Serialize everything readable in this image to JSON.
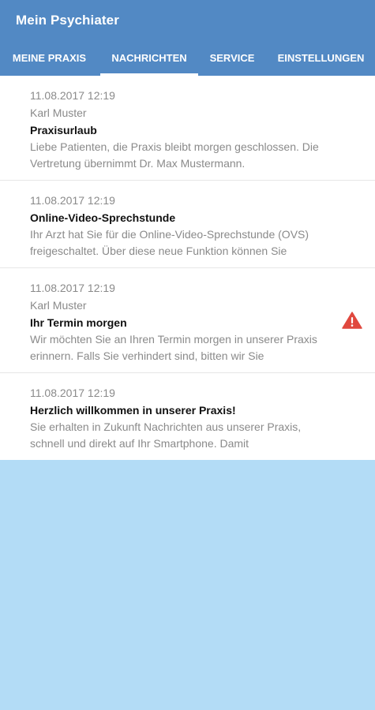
{
  "app": {
    "title": "Mein Psychiater",
    "colors": {
      "appbar": "#5289c4",
      "background": "#b3dcf6",
      "warning": "#e0483e"
    }
  },
  "tabs": [
    {
      "label": "MEINE PRAXIS",
      "selected": false
    },
    {
      "label": "NACHRICHTEN",
      "selected": true
    },
    {
      "label": "SERVICE",
      "selected": false
    },
    {
      "label": "EINSTELLUNGEN",
      "selected": false
    }
  ],
  "messages": [
    {
      "date": "11.08.2017 12:19",
      "sender": "Karl Muster",
      "title": "Praxisurlaub",
      "preview": "Liebe Patienten, die Praxis bleibt morgen geschlossen. Die Vertretung übernimmt Dr. Max Mustermann.",
      "icon": ""
    },
    {
      "date": "11.08.2017 12:19",
      "sender": "",
      "title": "Online-Video-Sprechstunde",
      "preview": "Ihr Arzt hat Sie für die Online-Video-Sprechstunde (OVS) freigeschaltet. Über diese neue Funktion können Sie",
      "icon": ""
    },
    {
      "date": "11.08.2017 12:19",
      "sender": "Karl Muster",
      "title": "Ihr Termin morgen",
      "preview": "Wir möchten Sie an Ihren Termin morgen in unserer Praxis erinnern. Falls Sie verhindert sind, bitten wir Sie",
      "icon": "warning-icon"
    },
    {
      "date": "11.08.2017 12:19",
      "sender": "",
      "title": "Herzlich willkommen in unserer Praxis!",
      "preview": "Sie erhalten in Zukunft Nachrichten aus unserer Praxis, schnell und direkt auf Ihr Smartphone. Damit",
      "icon": ""
    }
  ]
}
